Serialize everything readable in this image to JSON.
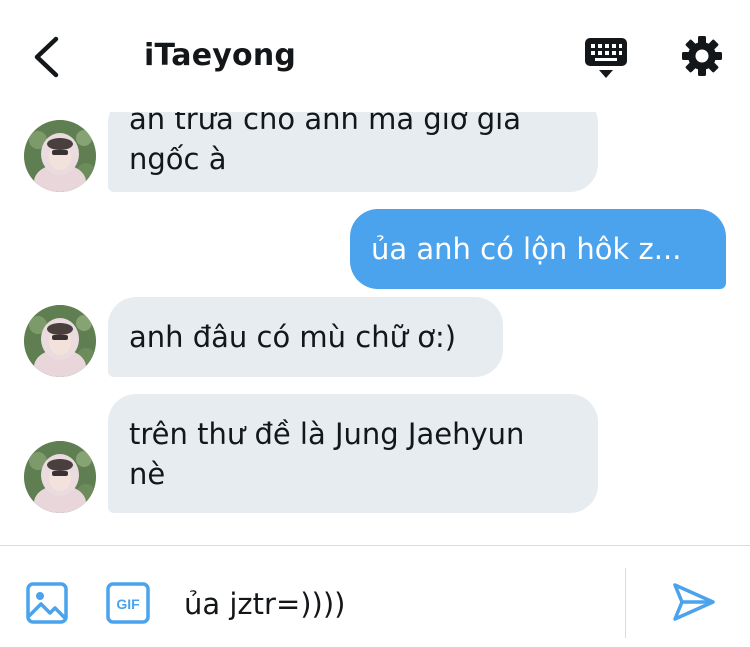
{
  "header": {
    "title": "iTaeyong",
    "back_icon": "chevron-left-icon",
    "keyboard_icon": "keyboard-icon",
    "settings_icon": "gear-icon"
  },
  "messages": [
    {
      "direction": "incoming",
      "lines": [
        "ăn trưa cho anh mà giờ giả",
        "ngốc à"
      ]
    },
    {
      "direction": "outgoing",
      "lines": [
        "ủa anh có lộn hôk z..."
      ]
    },
    {
      "direction": "incoming",
      "lines": [
        "anh đâu có mù chữ ơ:)"
      ]
    },
    {
      "direction": "incoming",
      "lines": [
        "trên thư đề là Jung Jaehyun",
        "nè"
      ]
    }
  ],
  "composer": {
    "media_icon": "image-icon",
    "gif_label": "GIF",
    "input_value": "ủa jztr=))))",
    "send_icon": "send-icon"
  },
  "colors": {
    "accent": "#4aa3ec",
    "incoming_bubble": "#e6ecf0",
    "icon_blue": "#4aa3ec",
    "text": "#14171a"
  }
}
